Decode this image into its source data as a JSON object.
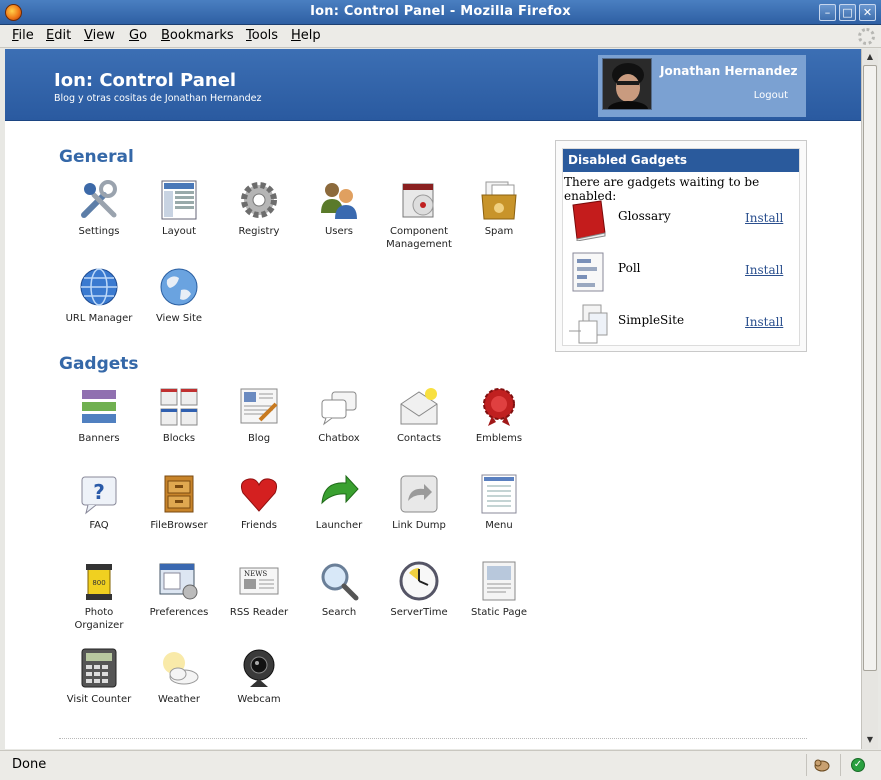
{
  "window": {
    "title": "Ion: Control Panel - Mozilla Firefox"
  },
  "menu": [
    "File",
    "Edit",
    "View",
    "Go",
    "Bookmarks",
    "Tools",
    "Help"
  ],
  "header": {
    "site_title": "Ion: Control Panel",
    "subtitle": "Blog y otras cositas de Jonathan Hernandez",
    "user_name": "Jonathan Hernandez",
    "logout": "Logout"
  },
  "general": {
    "heading": "General",
    "items": [
      {
        "label": "Settings",
        "icon": "settings-icon"
      },
      {
        "label": "Layout",
        "icon": "layout-icon"
      },
      {
        "label": "Registry",
        "icon": "registry-icon"
      },
      {
        "label": "Users",
        "icon": "users-icon"
      },
      {
        "label": "Component Management",
        "icon": "component-icon"
      },
      {
        "label": "Spam",
        "icon": "spam-icon"
      },
      {
        "label": "URL Manager",
        "icon": "url-manager-icon"
      },
      {
        "label": "View Site",
        "icon": "view-site-icon"
      }
    ]
  },
  "gadgets": {
    "heading": "Gadgets",
    "items": [
      {
        "label": "Banners",
        "icon": "banners-icon"
      },
      {
        "label": "Blocks",
        "icon": "blocks-icon"
      },
      {
        "label": "Blog",
        "icon": "blog-icon"
      },
      {
        "label": "Chatbox",
        "icon": "chatbox-icon"
      },
      {
        "label": "Contacts",
        "icon": "contacts-icon"
      },
      {
        "label": "Emblems",
        "icon": "emblems-icon"
      },
      {
        "label": "FAQ",
        "icon": "faq-icon"
      },
      {
        "label": "FileBrowser",
        "icon": "filebrowser-icon"
      },
      {
        "label": "Friends",
        "icon": "friends-icon"
      },
      {
        "label": "Launcher",
        "icon": "launcher-icon"
      },
      {
        "label": "Link Dump",
        "icon": "link-dump-icon"
      },
      {
        "label": "Menu",
        "icon": "menu-icon"
      },
      {
        "label": "Photo Organizer",
        "icon": "photo-organizer-icon"
      },
      {
        "label": "Preferences",
        "icon": "preferences-icon"
      },
      {
        "label": "RSS Reader",
        "icon": "rss-reader-icon"
      },
      {
        "label": "Search",
        "icon": "search-icon"
      },
      {
        "label": "ServerTime",
        "icon": "servertime-icon"
      },
      {
        "label": "Static Page",
        "icon": "static-page-icon"
      },
      {
        "label": "Visit Counter",
        "icon": "visit-counter-icon"
      },
      {
        "label": "Weather",
        "icon": "weather-icon"
      },
      {
        "label": "Webcam",
        "icon": "webcam-icon"
      }
    ]
  },
  "disabled": {
    "heading": "Disabled Gadgets",
    "text": "There are gadgets waiting to be enabled:",
    "install_label": "Install",
    "items": [
      {
        "name": "Glossary",
        "icon": "glossary-icon"
      },
      {
        "name": "Poll",
        "icon": "poll-icon"
      },
      {
        "name": "SimpleSite",
        "icon": "simplesite-icon"
      }
    ]
  },
  "status": {
    "text": "Done"
  },
  "colors": {
    "header_blue": "#2e5fa3",
    "link_blue": "#2a4f8e",
    "section_blue": "#3568a8"
  }
}
